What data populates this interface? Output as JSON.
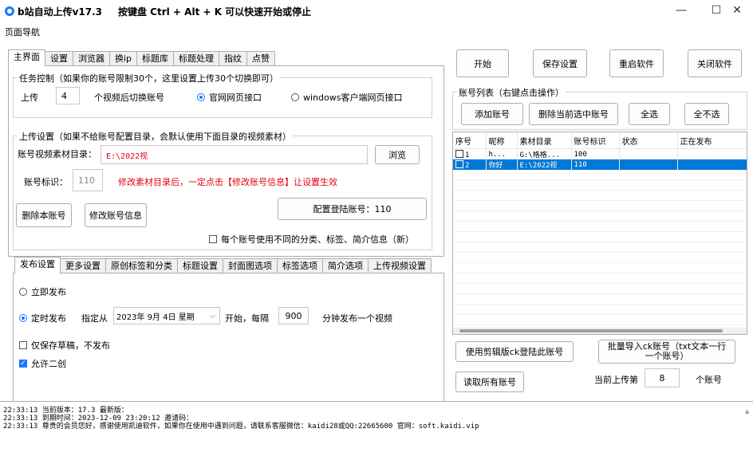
{
  "window": {
    "title": "b站自动上传v17.3",
    "hint": "按键盘 Ctrl + Alt + K  可以快速开始或停止",
    "minimize": "—",
    "maximize": "☐",
    "close": "✕"
  },
  "menu": {
    "page_nav": "页面导航"
  },
  "main_tabs": [
    "主界面",
    "设置",
    "浏览器",
    "换ip",
    "标题库",
    "标题处理",
    "指纹",
    "点赞"
  ],
  "task_control": {
    "title": "任务控制（如果你的账号限制30个，这里设置上传30个切换即可）",
    "upload_label": "上传",
    "upload_count": "4",
    "switch_label": "个视频后切换账号",
    "option_web": "官网网页接口",
    "option_client": "windows客户端网页接口"
  },
  "upload_settings": {
    "title": "上传设置（如果不给账号配置目录，会默认使用下面目录的视频素材）",
    "dir_label": "账号视频素材目录：",
    "dir_value": "E:\\2022视",
    "browse": "浏览",
    "id_label": "账号标识：",
    "id_value": "110",
    "warning": "修改素材目录后，一定点击【修改账号信息】让设置生效",
    "delete_account": "删除本账号",
    "modify_account": "修改账号信息",
    "config_login": "配置登陆账号：110",
    "diff_info": "每个账号使用不同的分类、标签、简介信息（新）"
  },
  "sub_tabs": [
    "发布设置",
    "更多设置",
    "原创标签和分类",
    "标题设置",
    "封面图选项",
    "标签选项",
    "简介选项",
    "上传视频设置"
  ],
  "publish": {
    "immediate": "立即发布",
    "scheduled": "定时发布",
    "from_label": "指定从",
    "date_value": "2023年 9月 4日 星期",
    "start_label": "开始，每隔",
    "interval": "900",
    "interval_suffix": "分钟发布一个视频",
    "draft_only": "仅保存草稿，不发布",
    "allow_remix": "允许二创"
  },
  "top_buttons": {
    "start": "开始",
    "save": "保存设置",
    "restart": "重启软件",
    "close_app": "关闭软件"
  },
  "accounts": {
    "title": "账号列表（右键点击操作）",
    "add": "添加账号",
    "delete_selected": "删除当前选中账号",
    "select_all": "全选",
    "select_none": "全不选",
    "columns": [
      "序号",
      "昵称",
      "素材目录",
      "账号标识",
      "状态",
      "正在发布"
    ],
    "rows": [
      [
        "1",
        "h...",
        "G:\\格格...",
        "100",
        "",
        ""
      ],
      [
        "2",
        "你好",
        "E:\\2022视",
        "110",
        "",
        ""
      ]
    ],
    "cut_login": "使用剪辑版ck登陆此账号",
    "batch_import": "批量导入ck账号（txt文本一行一个账号）",
    "read_all": "读取所有账号",
    "current_label": "当前上传第",
    "current_value": "8",
    "current_suffix": "个账号"
  },
  "log": [
    "22:33:13 当前版本：17.3    最新版：",
    "22:33:13 到期时间：2023-12-09 23:20:12 邀请码：",
    "22:33:13 尊贵的会员您好，感谢使用凯迪软件，如果你在使用中遇到问题，请联系客服微信：kaidi28或QQ:22665600 官网：soft.kaidi.vip"
  ],
  "colors": {
    "accent": "#1677ff",
    "warning": "#e60012",
    "selection": "#0078d7"
  }
}
